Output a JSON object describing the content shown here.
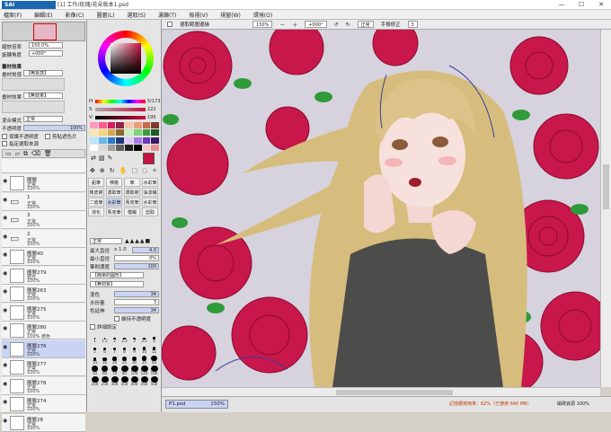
{
  "window": {
    "logo": "SAI",
    "title": "[1] 工作/玫瑰/花朵版本1.psd",
    "controls": [
      "—",
      "☐",
      "✕"
    ]
  },
  "menu": [
    "檔案(F)",
    "編輯(E)",
    "影像(C)",
    "圖層(L)",
    "選取(S)",
    "濾鏡(T)",
    "檢視(V)",
    "視窗(W)",
    "環境(O)"
  ],
  "navigator": {
    "zoom_label": "縮放倍率",
    "zoom": "150.0%",
    "angle_label": "旋轉角度",
    "angle": "+000°"
  },
  "texture": {
    "section": "畫材效果",
    "paper_label": "畫材質感",
    "paper_value": "【無質感】",
    "effect_label": "畫材效果",
    "effect_value": "【無效果】"
  },
  "blend": {
    "mode_label": "混合模式",
    "mode_value": "正常",
    "opacity_label": "不透明度",
    "opacity": "100%",
    "protect_label": "保護不透明度",
    "clip_label": "剪貼遮色片",
    "select_source_label": "指定選取來源"
  },
  "layers": [
    {
      "name": "圖層",
      "mode": "正常",
      "opacity": "100%",
      "kind": "layer"
    },
    {
      "name": "1",
      "mode": "正常",
      "opacity": "100%",
      "kind": "folder"
    },
    {
      "name": "3",
      "mode": "正常",
      "opacity": "100%",
      "kind": "folder"
    },
    {
      "name": "2",
      "mode": "正常",
      "opacity": "100%",
      "kind": "folder"
    },
    {
      "name": "圖層40",
      "mode": "正常",
      "opacity": "100%",
      "kind": "layer"
    },
    {
      "name": "圖層279",
      "mode": "發光",
      "opacity": "100%",
      "kind": "layer"
    },
    {
      "name": "圖層263",
      "mode": "正常",
      "opacity": "100%",
      "kind": "layer"
    },
    {
      "name": "圖層275",
      "mode": "正常",
      "opacity": "100%",
      "kind": "layer"
    },
    {
      "name": "圖層280",
      "mode": "正常",
      "opacity": "100% 遮色",
      "kind": "layer"
    },
    {
      "name": "圖層276",
      "mode": "正常",
      "opacity": "100%",
      "kind": "layer",
      "selected": true
    },
    {
      "name": "圖層277",
      "mode": "正常",
      "opacity": "100%",
      "kind": "layer"
    },
    {
      "name": "圖層278",
      "mode": "正常",
      "opacity": "100%",
      "kind": "layer"
    },
    {
      "name": "圖層274",
      "mode": "正常",
      "opacity": "100%",
      "kind": "layer"
    },
    {
      "name": "圖層28",
      "mode": "正常",
      "opacity": "100%",
      "kind": "layer"
    }
  ],
  "color": {
    "h_label": "H",
    "h": "5/173",
    "s_label": "S",
    "s": "222",
    "v_label": "V",
    "v": "195",
    "primary": "#c8123f",
    "secondary": "#ffffff",
    "palette": [
      "#ff9ac0",
      "#ff5c8a",
      "#d81b60",
      "#8e244d",
      "#f8c4a8",
      "#e8a07a",
      "#c96b4a",
      "#7b3d2a",
      "#fde7b0",
      "#f6d37a",
      "#d4a94a",
      "#8c6a2a",
      "#c8f0c0",
      "#7fd37a",
      "#3c9b3c",
      "#1f5a28",
      "#b8e4f8",
      "#6ab8e8",
      "#2a78c8",
      "#1a3a78",
      "#e0c8f8",
      "#a878e8",
      "#6a38b8",
      "#3a1a68",
      "#ffffff",
      "#d8d8d8",
      "#a0a0a0",
      "#606060",
      "#202020",
      "#000000",
      "#f2c6c6",
      "#e89090"
    ]
  },
  "tools": {
    "row1": [
      "鉛筆",
      "噴槍",
      "筆",
      "水彩筆"
    ],
    "row2": [
      "橡皮擦",
      "選取筆",
      "選取擦",
      "油漆桶"
    ],
    "row3": [
      "二值筆",
      "水彩筆",
      "馬克筆",
      "水彩筆"
    ],
    "row4": [
      "液化",
      "馬克筆",
      "模糊",
      "剪取"
    ]
  },
  "brush": {
    "mode": "正常",
    "size_label": "最大直徑",
    "size_mult": "x 1.0",
    "size": "4.0",
    "min_label": "最小直徑",
    "min": "0%",
    "density_label": "筆刷濃度",
    "density": "100",
    "shape_label": "【簡單的圓形】",
    "texture_label": "【無材質】",
    "mix_label": "混色",
    "mix": "34",
    "water_label": "水份量",
    "water": "3",
    "persist_label": "色延伸",
    "persist": "34",
    "keep_opacity_label": "維持不透明度",
    "detail_label": "詳細設定",
    "sizes": [
      "1",
      "1.5",
      "2",
      "2.3",
      "3",
      "3.5",
      "4",
      "5",
      "6",
      "7",
      "8",
      "9",
      "10",
      "12",
      "14",
      "16",
      "20",
      "25",
      "30",
      "35",
      "40",
      "50",
      "60",
      "70",
      "80",
      "100",
      "120",
      "160",
      "200",
      "250",
      "300",
      "350",
      "400",
      "450",
      "500"
    ]
  },
  "toolbar": {
    "stabilizer_label": "選取範圍邊緣",
    "zoom": "150%",
    "angle": "+000°",
    "mode": "正常",
    "correction_label": "手振修正",
    "correction": "3"
  },
  "statusbar": {
    "tab": "P1.psd",
    "tab_zoom": "150%",
    "right_text": "記憶體使用率：62%（已使用 640 MB）",
    "right_label": "磁碟資源 100%"
  }
}
